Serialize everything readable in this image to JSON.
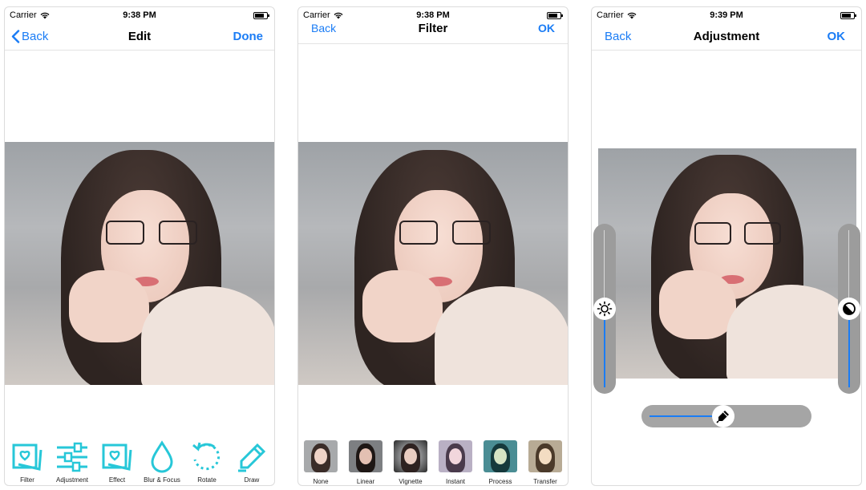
{
  "colors": {
    "accent": "#1a7cf5",
    "tool_icon": "#27c7d8",
    "slider_bg": "#9c9c9c"
  },
  "screens": [
    {
      "status": {
        "carrier": "Carrier",
        "time": "9:38 PM"
      },
      "nav": {
        "left": "Back",
        "title": "Edit",
        "right": "Done"
      },
      "tools": [
        {
          "label": "Filter",
          "icon": "filter-icon"
        },
        {
          "label": "Adjustment",
          "icon": "adjustment-icon"
        },
        {
          "label": "Effect",
          "icon": "effect-icon"
        },
        {
          "label": "Blur & Focus",
          "icon": "blur-focus-icon"
        },
        {
          "label": "Rotate",
          "icon": "rotate-icon"
        },
        {
          "label": "Draw",
          "icon": "draw-icon"
        }
      ]
    },
    {
      "status": {
        "carrier": "Carrier",
        "time": "9:38 PM"
      },
      "nav": {
        "left": "Back",
        "title": "Filter",
        "right": "OK"
      },
      "filters": [
        {
          "label": "None"
        },
        {
          "label": "Linear"
        },
        {
          "label": "Vignette"
        },
        {
          "label": "Instant"
        },
        {
          "label": "Process"
        },
        {
          "label": "Transfer"
        }
      ]
    },
    {
      "status": {
        "carrier": "Carrier",
        "time": "9:39 PM"
      },
      "nav": {
        "left": "Back",
        "title": "Adjustment",
        "right": "OK"
      },
      "sliders": {
        "brightness": {
          "icon": "brightness-icon",
          "level": 0.5
        },
        "contrast": {
          "icon": "contrast-icon",
          "level": 0.5
        },
        "saturation": {
          "icon": "saturation-icon",
          "level": 0.48
        }
      }
    }
  ]
}
